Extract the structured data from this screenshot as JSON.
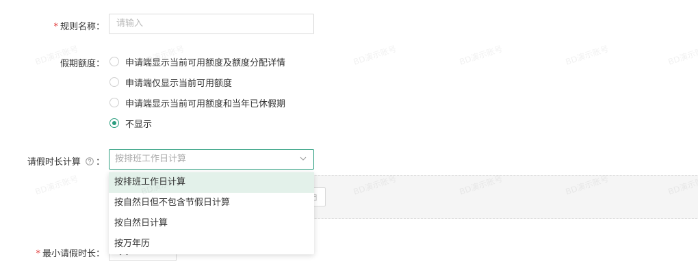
{
  "form": {
    "rule_name": {
      "label": "规则名称：",
      "placeholder": "请输入"
    },
    "quota": {
      "label": "假期额度：",
      "options": [
        {
          "text": "申请端显示当前可用额度及额度分配详情",
          "checked": false
        },
        {
          "text": "申请端仅显示当前可用额度",
          "checked": false
        },
        {
          "text": "申请端显示当前可用额度和当年已休假期",
          "checked": false
        },
        {
          "text": "不显示",
          "checked": true
        }
      ]
    },
    "duration_calc": {
      "label": "请假时长计算",
      "colon": "：",
      "selected": "按排班工作日计算",
      "help_icon": "question-circle-icon",
      "chevron_icon": "chevron-down-icon",
      "options": [
        "按排班工作日计算",
        "按自然日但不包含节假日计算",
        "按自然日计算",
        "按万年历"
      ]
    },
    "min_duration": {
      "label": "最小请假时长：",
      "value": "1天"
    }
  },
  "watermark": {
    "text": "BD演示账号"
  },
  "colors": {
    "accent": "#2a9d7e",
    "required": "#e03a3a",
    "option_active_bg": "#e3f1ea"
  }
}
